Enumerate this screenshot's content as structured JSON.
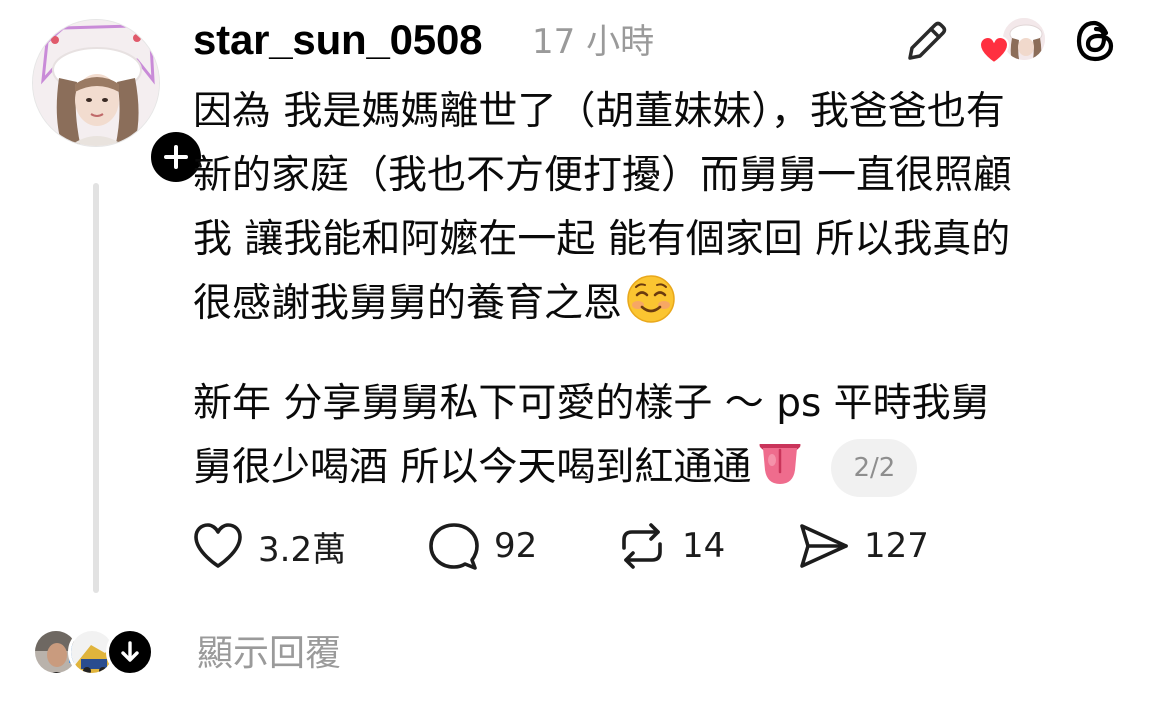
{
  "post": {
    "username": "star_sun_0508",
    "timestamp": "17 小時",
    "paragraph1": {
      "line1": "因為 我是媽媽離世了（胡董妹妹），我爸爸也有",
      "line2": "新的家庭（我也不方便打擾）而舅舅一直很照顧",
      "line3": "我 讓我能和阿嬤在一起 能有個家回 所以我真的",
      "line4": "很感謝我舅舅的養育之恩",
      "line4_emoji": "smiling-face-icon"
    },
    "paragraph2": {
      "line1": "新年 分享舅舅私下可愛的樣子 ～ ps 平時我舅",
      "line2": "舅很少喝酒 所以今天喝到紅通通",
      "line2_emoji": "tongue-icon"
    },
    "page_indicator": "2/2"
  },
  "actions": {
    "likes": "3.2萬",
    "comments": "92",
    "reposts": "14",
    "shares": "127"
  },
  "replies": {
    "label": "顯示回覆"
  },
  "icons": {
    "edit": "pencil-icon",
    "liked_by": "heart-icon",
    "app": "threads-logo-icon",
    "follow": "plus-icon",
    "expand": "arrow-down-icon",
    "like": "heart-outline-icon",
    "comment": "comment-bubble-icon",
    "repost": "repost-icon",
    "share": "send-icon"
  },
  "colors": {
    "text": "#0a0a0a",
    "muted": "#9a9a9a",
    "heart": "#ff3040",
    "thread_line": "#e2e2e2",
    "pill_bg": "#f1f1f1"
  }
}
